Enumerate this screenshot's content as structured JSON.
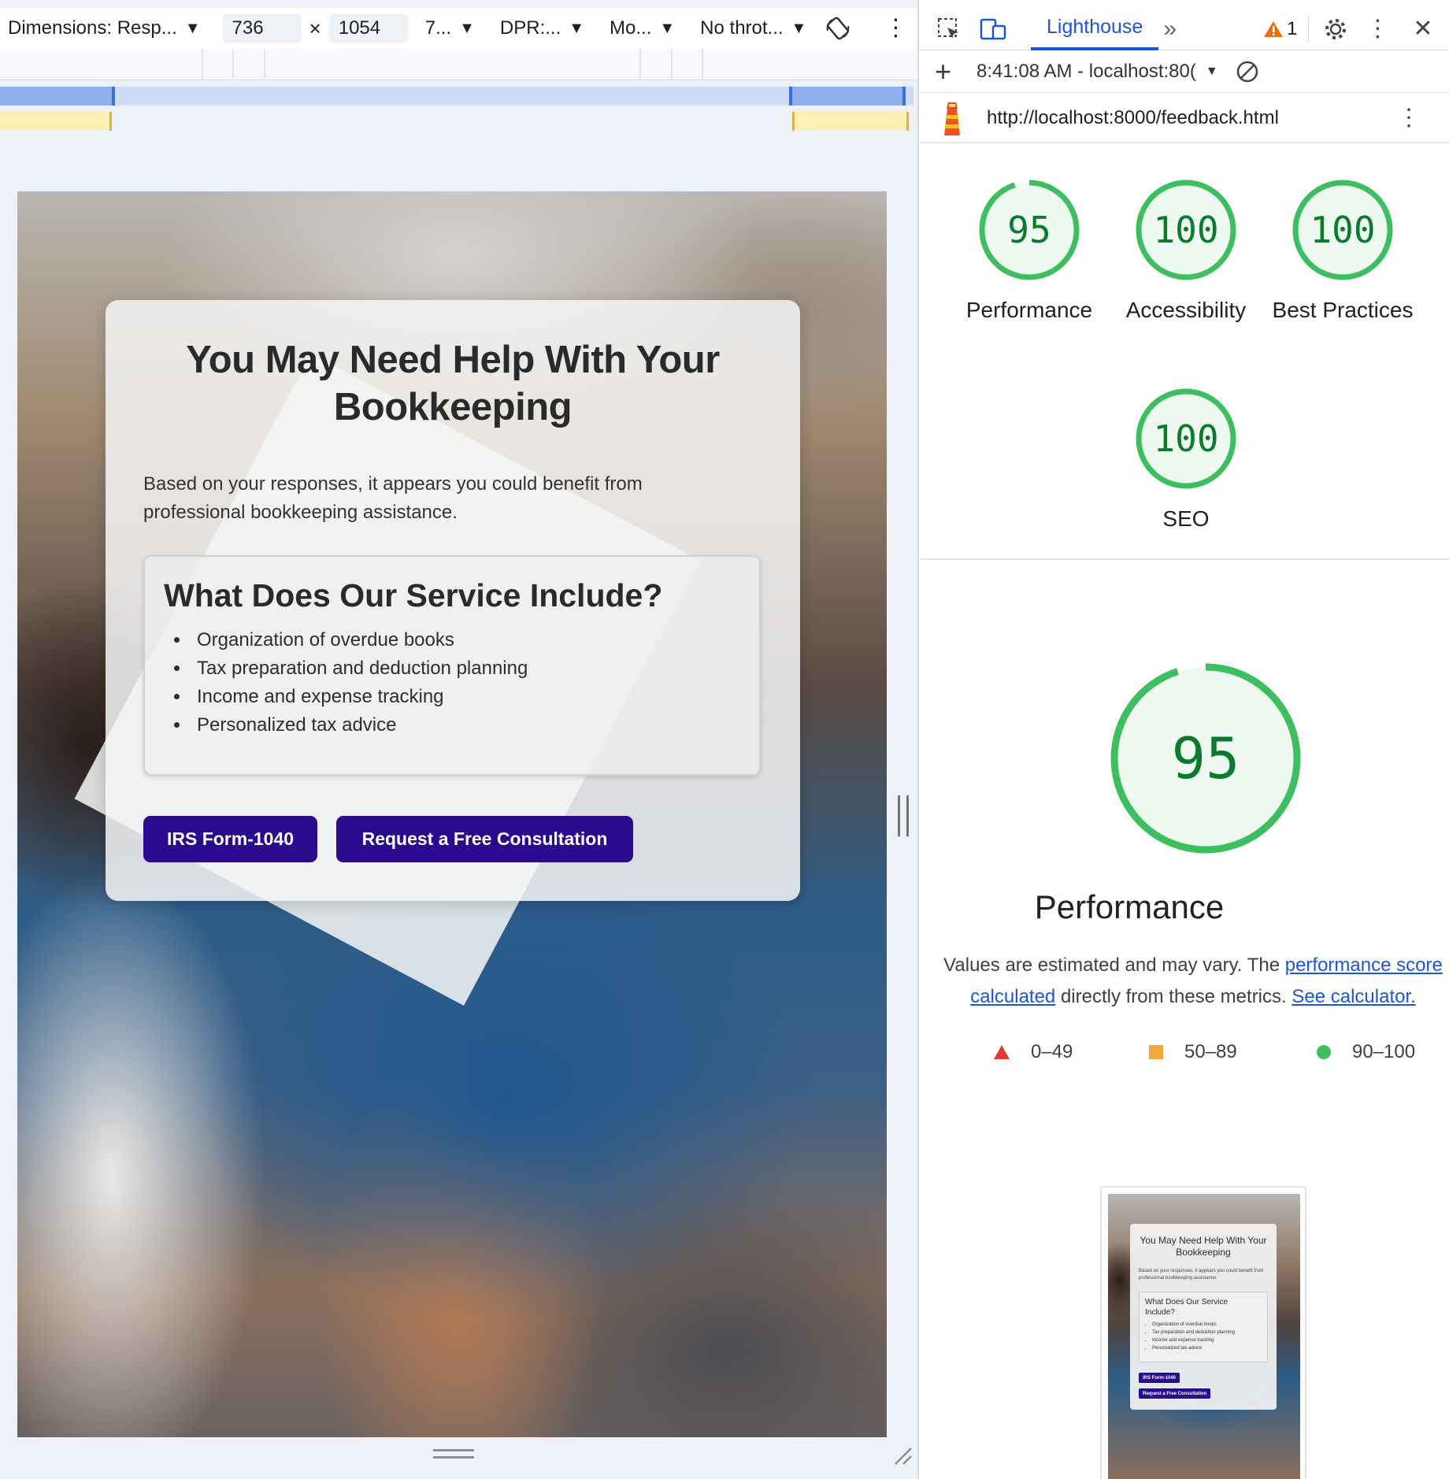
{
  "device_toolbar": {
    "dimensions_label": "Dimensions: Resp...",
    "width_value": "736",
    "times": "×",
    "height_value": "1054",
    "zoom_label": "7...",
    "dpr_label": "DPR:...",
    "mode_label": "Mo...",
    "throttle_label": "No throt..."
  },
  "emulated_page": {
    "title": "You May Need Help With Your Bookkeeping",
    "intro": "Based on your responses, it appears you could benefit from professional bookkeeping assistance.",
    "services_title": "What Does Our Service Include?",
    "services": [
      "Organization of overdue books",
      "Tax preparation and deduction planning",
      "Income and expense tracking",
      "Personalized tax advice"
    ],
    "buttons": {
      "irs": "IRS Form-1040",
      "consult": "Request a Free Consultation"
    },
    "brand_color": "#2a0a8e"
  },
  "devtools": {
    "active_tab": "Lighthouse",
    "more_tabs": "»",
    "warning_count": "1",
    "report": {
      "time_host": "8:41:08 AM - localhost:80(",
      "url": "http://localhost:8000/feedback.html"
    },
    "scores": [
      {
        "label": "Performance",
        "value": 95
      },
      {
        "label": "Accessibility",
        "value": 100
      },
      {
        "label": "Best Practices",
        "value": 100
      },
      {
        "label": "SEO",
        "value": 100
      }
    ],
    "performance": {
      "value": 95,
      "label": "Performance",
      "desc_prefix": "Values are estimated and may vary. The ",
      "desc_link1": "performance score calculated",
      "desc_middle": " directly from these metrics. ",
      "desc_link2": "See calculator."
    },
    "legend": [
      {
        "range": "0–49",
        "color": "#e53935"
      },
      {
        "range": "50–89",
        "color": "#f4a83a"
      },
      {
        "range": "90–100",
        "color": "#3dbf60"
      }
    ],
    "pass_color": "#3dbf60"
  }
}
